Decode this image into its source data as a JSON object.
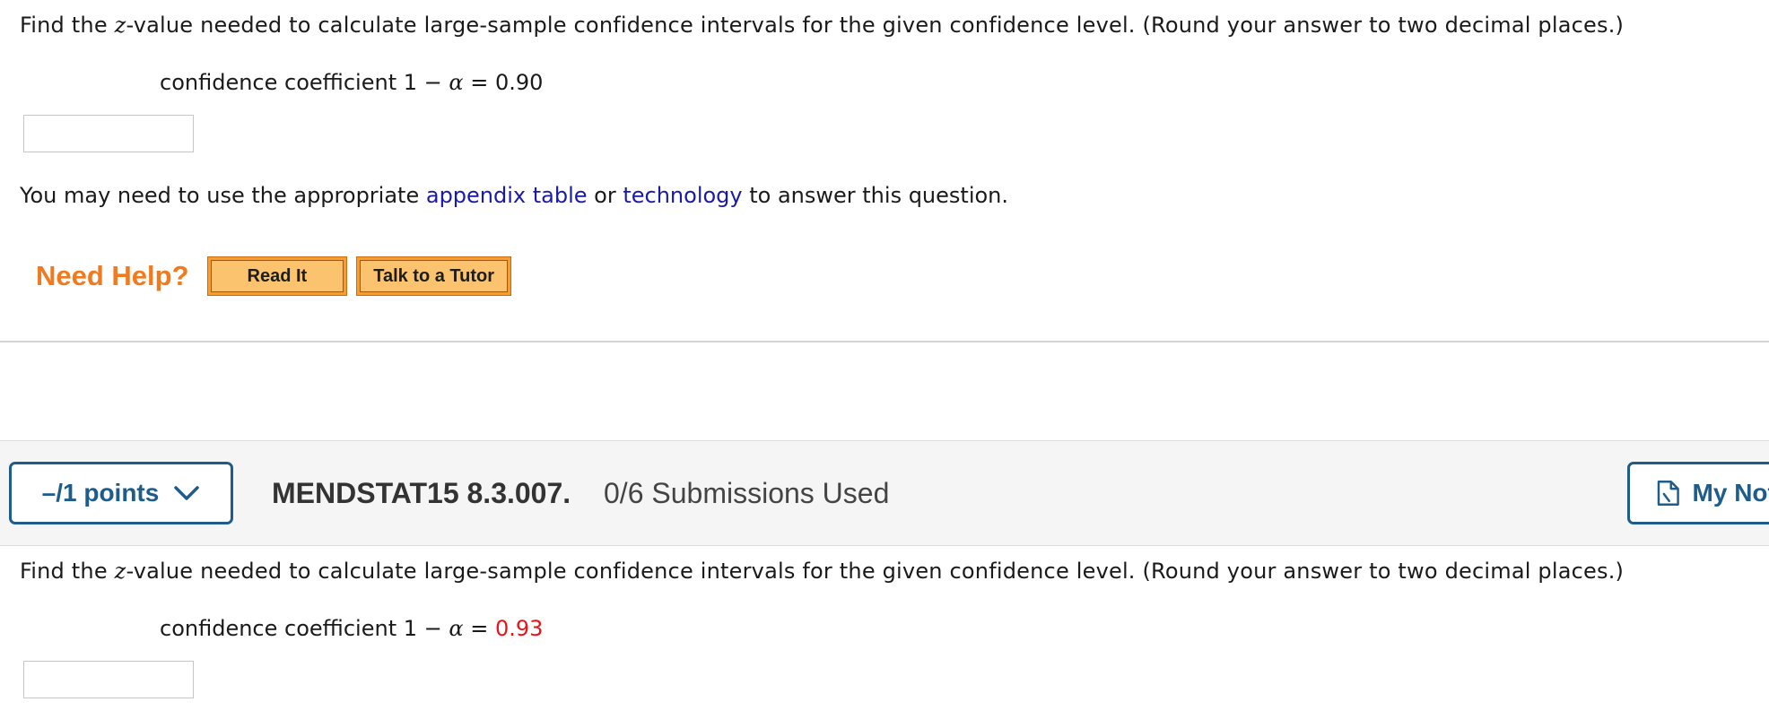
{
  "question1": {
    "prompt_before": "Find the ",
    "prompt_var": "z",
    "prompt_after": "-value needed to calculate large-sample confidence intervals for the given confidence level. (Round your answer to two decimal places.)",
    "coef_label": "confidence coefficient 1 − ",
    "coef_alpha": "α",
    "coef_eq": " = ",
    "coef_value": "0.90",
    "answer_value": ""
  },
  "note": {
    "before": "You may need to use the appropriate ",
    "link1": "appendix table",
    "middle": " or ",
    "link2": "technology",
    "after": " to answer this question."
  },
  "help": {
    "label": "Need Help?",
    "read_it": "Read It",
    "tutor": "Talk to a Tutor"
  },
  "question2_header": {
    "points": "–/1 points",
    "id": "MENDSTAT15 8.3.007.",
    "submissions": "0/6 Submissions Used",
    "notes_button": "My Notes"
  },
  "question2": {
    "prompt_before": "Find the ",
    "prompt_var": "z",
    "prompt_after": "-value needed to calculate large-sample confidence intervals for the given confidence level. (Round your answer to two decimal places.)",
    "coef_label": "confidence coefficient 1 − ",
    "coef_alpha": "α",
    "coef_eq": " = ",
    "coef_value": "0.93",
    "coef_value_color": "#e8141b",
    "answer_value": ""
  },
  "colors": {
    "accent": "#1d5c8b",
    "link": "#1a1aa8",
    "help_orange": "#f07a1d"
  },
  "icons": {
    "points_chevron": "chevron-down-icon",
    "notes": "notes-document-icon"
  }
}
